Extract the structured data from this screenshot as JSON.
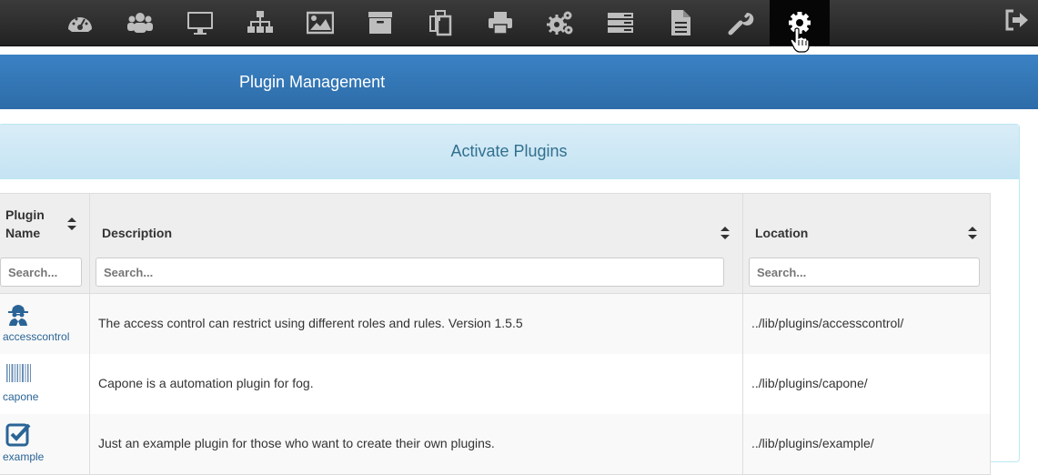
{
  "nav": {
    "items": [
      {
        "icon": "dashboard-icon"
      },
      {
        "icon": "users-icon"
      },
      {
        "icon": "host-monitor-icon"
      },
      {
        "icon": "groups-sitemap-icon"
      },
      {
        "icon": "images-icon"
      },
      {
        "icon": "storage-archive-icon"
      },
      {
        "icon": "snapins-copy-icon"
      },
      {
        "icon": "printer-icon"
      },
      {
        "icon": "services-cogs-icon"
      },
      {
        "icon": "tasks-list-icon"
      },
      {
        "icon": "reports-file-icon"
      },
      {
        "icon": "settings-wrench-icon"
      },
      {
        "icon": "plugins-gear-icon",
        "active": true
      }
    ],
    "logout_icon": "logout-icon"
  },
  "header": {
    "title": "Plugin Management"
  },
  "panel": {
    "title": "Activate Plugins"
  },
  "table": {
    "columns": [
      {
        "line1": "Plugin",
        "line2": "Name"
      },
      {
        "label": "Description"
      },
      {
        "label": "Location"
      }
    ],
    "search_placeholders": [
      "Search...",
      "Search...",
      "Search..."
    ],
    "rows": [
      {
        "name": "accesscontrol",
        "icon": "user-secret-icon",
        "description": "The access control can restrict using different roles and rules. Version 1.5.5",
        "location": "../lib/plugins/accesscontrol/"
      },
      {
        "name": "capone",
        "icon": "barcode-icon",
        "description": "Capone is a automation plugin for fog.",
        "location": "../lib/plugins/capone/"
      },
      {
        "name": "example",
        "icon": "checkbox-icon",
        "description": "Just an example plugin for those who want to create their own plugins.",
        "location": "../lib/plugins/example/"
      }
    ]
  },
  "colors": {
    "navbar": "#2c2c2c",
    "header": "#337ab7",
    "panel_heading": "#d9edf7",
    "panel_title": "#31708f",
    "link": "#2a6496"
  }
}
